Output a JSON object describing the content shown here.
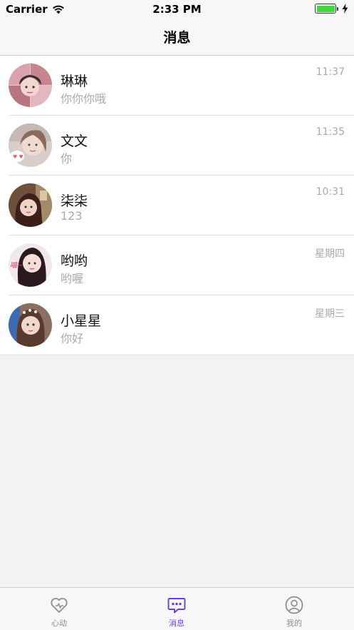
{
  "status_bar": {
    "carrier": "Carrier",
    "time": "2:33 PM"
  },
  "nav": {
    "title": "消息"
  },
  "conversations": [
    {
      "name": "琳琳",
      "preview": "你你你哦",
      "time": "11:37"
    },
    {
      "name": "文文",
      "preview": "你",
      "time": "11:35"
    },
    {
      "name": "柒柒",
      "preview": "123",
      "time": "10:31"
    },
    {
      "name": "哟哟",
      "preview": "哟喔",
      "time": "星期四"
    },
    {
      "name": "小星星",
      "preview": "你好",
      "time": "星期三"
    }
  ],
  "tabs": [
    {
      "label": "心动",
      "icon": "heart-icon",
      "active": false
    },
    {
      "label": "消息",
      "icon": "chat-bubble-icon",
      "active": true
    },
    {
      "label": "我的",
      "icon": "profile-icon",
      "active": false
    }
  ],
  "colors": {
    "accent": "#6a3ee6",
    "inactive": "#8e8e93",
    "battery": "#3ed93e"
  }
}
